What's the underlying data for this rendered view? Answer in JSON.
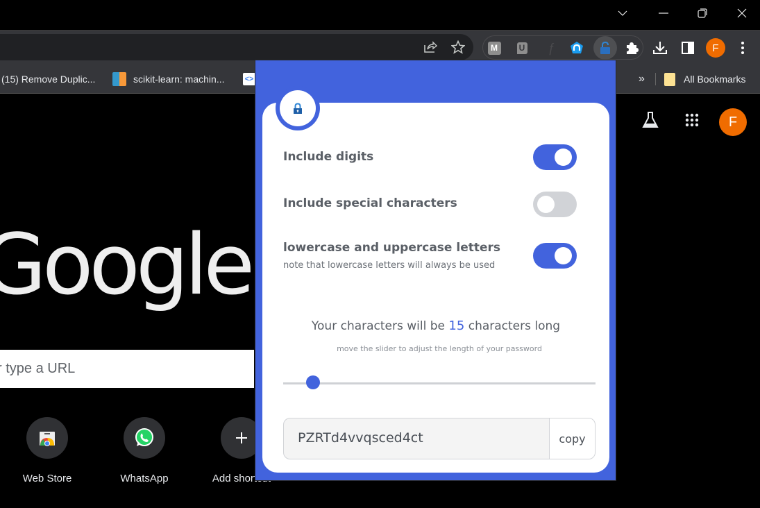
{
  "window": {
    "controls": {
      "tab_search": "tab-search",
      "minimize": "minimize",
      "restore": "restore",
      "close": "close"
    }
  },
  "toolbar": {
    "extensions": [
      "mail-extension",
      "u-extension",
      "faded-extension",
      "magnet-extension",
      "password-generator-extension",
      "extensions-puzzle"
    ],
    "profile_initial": "F",
    "profile_color": "#f06c00"
  },
  "bookmarks": {
    "items": [
      {
        "label": "(15) Remove Duplic..."
      },
      {
        "label": "scikit-learn: machin..."
      },
      {
        "label": ""
      }
    ],
    "overflow": "»",
    "all_bookmarks": "All Bookmarks"
  },
  "ntp": {
    "logo": "Google",
    "search_placeholder": "r type a URL",
    "profile_initial": "F",
    "shortcuts": [
      {
        "label": "Web Store"
      },
      {
        "label": "WhatsApp"
      },
      {
        "label": "Add shortcut"
      }
    ]
  },
  "popup": {
    "accent": "#4263dd",
    "options": [
      {
        "label": "Include digits",
        "enabled": true
      },
      {
        "label": "Include special characters",
        "enabled": false
      },
      {
        "label": "lowercase and uppercase letters",
        "note": "note that lowercase letters will always be used",
        "enabled": true
      }
    ],
    "length_prefix": "Your characters will be ",
    "length_value": "15",
    "length_suffix": " characters long",
    "length_hint": "move the slider to adjust the length of your password",
    "slider": {
      "value": 15,
      "fraction": 0.095
    },
    "password": "PZRTd4vvqsced4ct",
    "copy_label": "copy"
  }
}
